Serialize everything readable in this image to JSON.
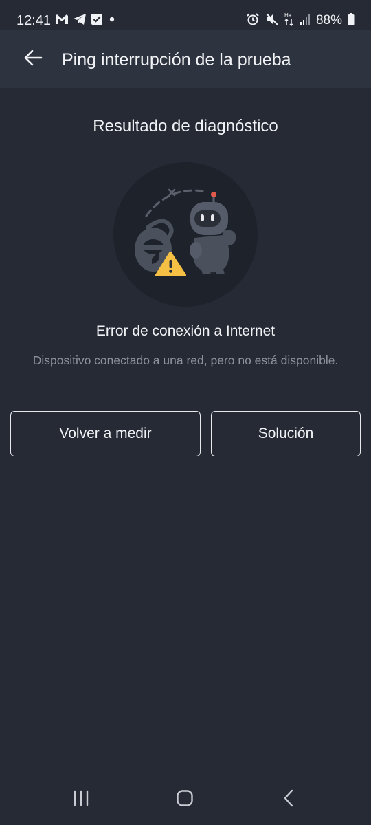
{
  "status_bar": {
    "time": "12:41",
    "battery": "88%",
    "left_icons": [
      "gmail-icon",
      "telegram-icon",
      "check-square-icon",
      "dot-icon"
    ],
    "right_icons": [
      "alarm-icon",
      "mute-icon",
      "data-arrows-icon",
      "signal-icon",
      "battery-icon"
    ]
  },
  "app_bar": {
    "title": "Ping interrupción de la prueba",
    "back_icon": "arrow-left-icon"
  },
  "content": {
    "section_title": "Resultado de diagnóstico",
    "illustration": "robot-with-browser-warning",
    "error_title": "Error de conexión a Internet",
    "error_description": "Dispositivo conectado a una red, pero no está disponible."
  },
  "buttons": {
    "remeasure_label": "Volver a medir",
    "solution_label": "Solución"
  },
  "colors": {
    "background": "#262a35",
    "app_bar": "#2e343f",
    "text_primary": "#f1f2f5",
    "text_secondary": "#8d929c",
    "warning": "#f5c044",
    "robot_accent": "#e25a4b"
  },
  "nav_bar": {
    "icons": [
      "recent-apps-icon",
      "home-icon",
      "back-icon"
    ]
  }
}
